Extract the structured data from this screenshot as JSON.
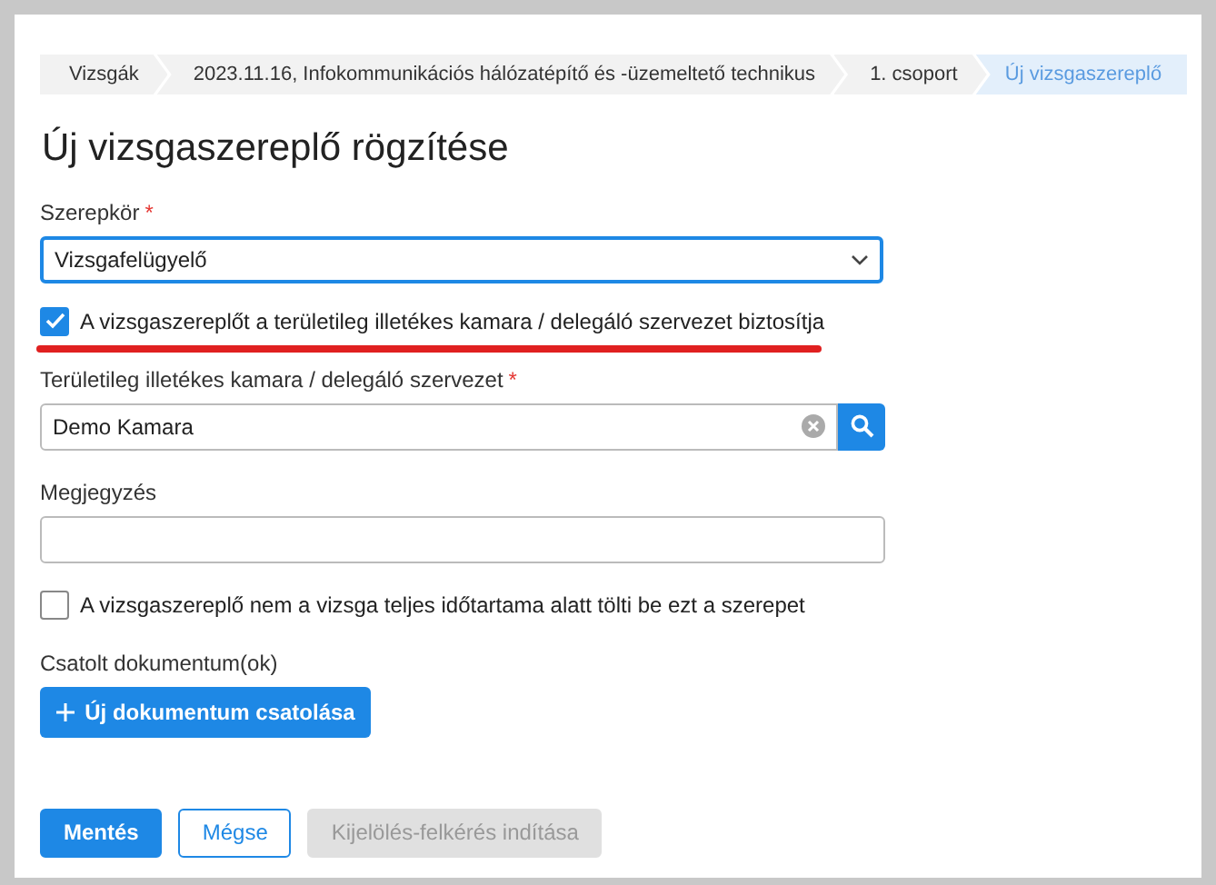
{
  "breadcrumb": [
    {
      "label": "Vizsgák",
      "selected": false
    },
    {
      "label": "2023.11.16, Infokommunikációs hálózatépítő és -üzemeltető technikus",
      "selected": false
    },
    {
      "label": "1. csoport",
      "selected": false
    },
    {
      "label": "Új vizsgaszereplő",
      "selected": true
    }
  ],
  "title": "Új vizsgaszereplő rögzítése",
  "role": {
    "label": "Szerepkör",
    "required_mark": "*",
    "value": "Vizsgafelügyelő"
  },
  "delegated": {
    "label": "A vizsgaszereplőt a területileg illetékes kamara / delegáló szervezet biztosítja",
    "checked": true,
    "highlighted": true
  },
  "organization": {
    "label": "Területileg illetékes kamara / delegáló szervezet",
    "required_mark": "*",
    "value": "Demo Kamara"
  },
  "note": {
    "label": "Megjegyzés"
  },
  "partial": {
    "label": "A vizsgaszereplő nem a vizsga teljes időtartama alatt tölti be ezt a szerepet",
    "checked": false
  },
  "attachments": {
    "label": "Csatolt dokumentum(ok)",
    "button": "Új dokumentum csatolása"
  },
  "actions": [
    {
      "label": "Mentés",
      "kind": "primary"
    },
    {
      "label": "Mégse",
      "kind": "outline"
    },
    {
      "label": "Kijelölés-felkérés indítása",
      "kind": "disabled"
    }
  ]
}
